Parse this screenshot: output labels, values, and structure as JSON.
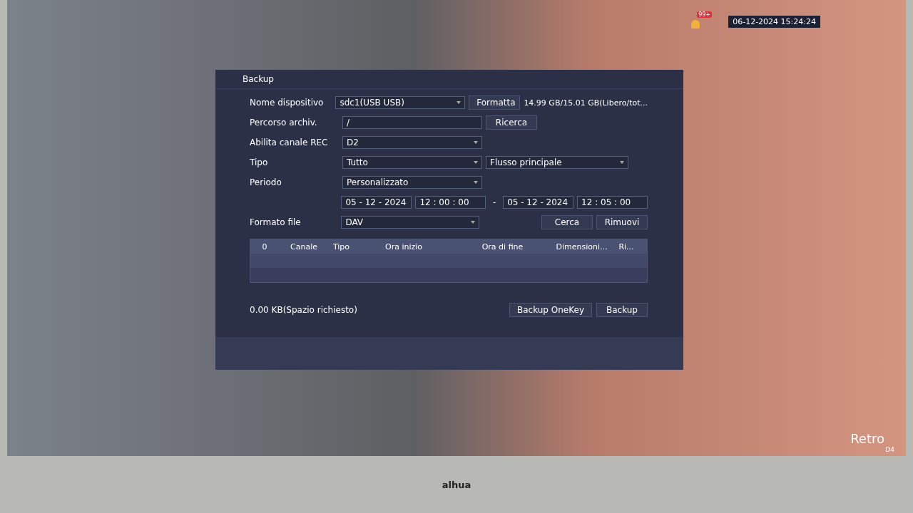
{
  "status_bar": {
    "alarm_badge": "99+",
    "datetime": "06-12-2024 15:24:24"
  },
  "channel_label": {
    "name": "Retro",
    "channel": "D4"
  },
  "dialog": {
    "title": "Backup",
    "fields": [
      {
        "kind": "select",
        "label": "Nome dispositivo",
        "value": "sdc1(USB USB)",
        "button": "Formatta",
        "info": "14.99 GB/15.01 GB(Libero/tot..."
      },
      {
        "kind": "input",
        "label": "Percorso archiv.",
        "value": "/",
        "button": "Ricerca"
      },
      {
        "kind": "select",
        "label": "Abilita canale REC",
        "value": "D2"
      },
      {
        "kind": "select",
        "label": "Tipo",
        "value": "Tutto",
        "second": "Flusso principale"
      },
      {
        "kind": "select",
        "label": "Periodo",
        "value": "Personalizzato"
      },
      {
        "kind": "range",
        "start_date": "05 - 12 -  2024",
        "start_time": "12 : 00 : 00",
        "separator": "-",
        "end_date": "05 - 12 -  2024",
        "end_time": "12 : 05 : 00"
      },
      {
        "kind": "select",
        "label": "Formato file",
        "value": "DAV",
        "buttons": [
          "Cerca",
          "Rimuovi"
        ]
      }
    ],
    "table": {
      "columns": [
        "0",
        "Canale",
        "Tipo",
        "Ora inizio",
        "Ora di fine",
        "Dimensioni...",
        "Ri..."
      ]
    },
    "space": "0.00 KB(Spazio richiesto)",
    "buttons": [
      "Backup OneKey",
      "Backup"
    ]
  },
  "bezel": {
    "logo": "alhua"
  }
}
